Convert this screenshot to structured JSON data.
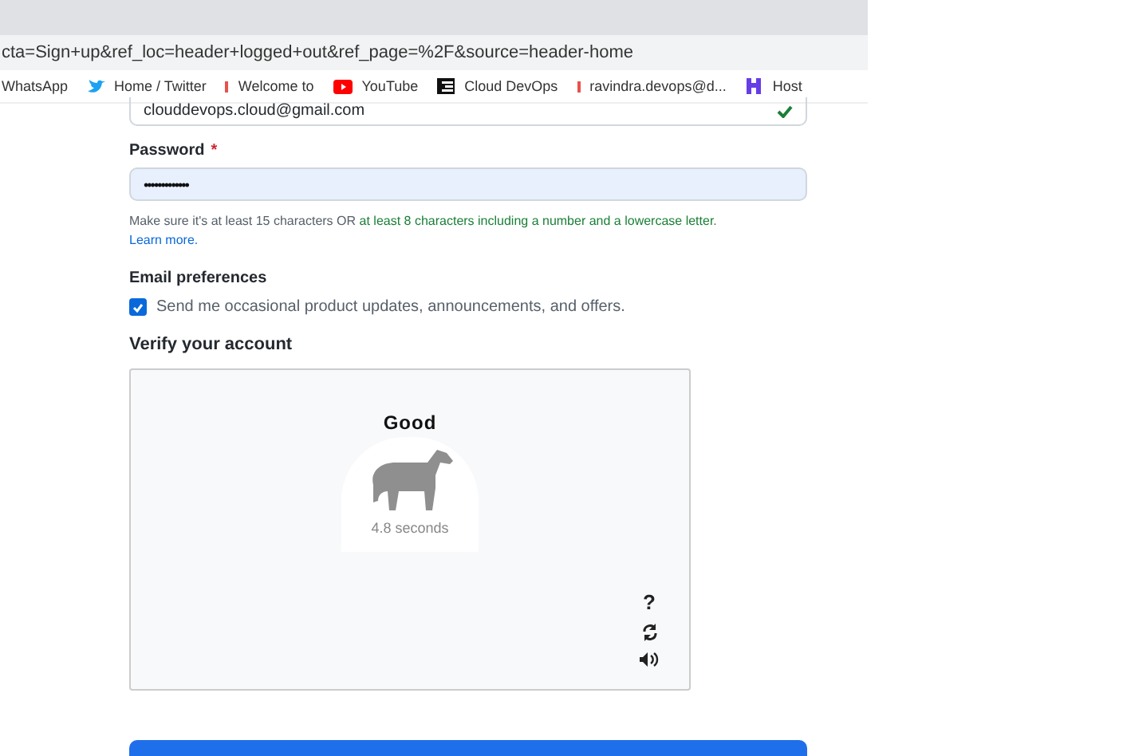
{
  "address_bar": {
    "url": "cta=Sign+up&ref_loc=header+logged+out&ref_page=%2F&source=header-home"
  },
  "bookmarks": [
    {
      "kind": "plain",
      "label": "WhatsApp"
    },
    {
      "kind": "bird",
      "label": "Home / Twitter"
    },
    {
      "kind": "bar",
      "label": "Welcome to"
    },
    {
      "kind": "video",
      "label": "YouTube"
    },
    {
      "kind": "lines",
      "label": "Cloud DevOps"
    },
    {
      "kind": "bar",
      "label": "ravindra.devops@d..."
    },
    {
      "kind": "logo",
      "label": "Host"
    }
  ],
  "email": {
    "value": "clouddevops.cloud@gmail.com",
    "valid": true
  },
  "password": {
    "label": "Password",
    "required_mark": "*",
    "value": "•••••••••••••"
  },
  "hint": [
    {
      "text": "Make sure it's at least 15 characters OR",
      "met": false
    },
    {
      "text": "at least 8 characters including a number and a lowercase letter.",
      "met": true
    }
  ],
  "learn_more": "Learn more.",
  "preferences": {
    "title": "Email preferences",
    "checked": true,
    "label": "Send me occasional product updates, announcements, and offers."
  },
  "verify": {
    "title": "Verify your account",
    "result": "Good",
    "time": "4.8 seconds",
    "help": "?"
  }
}
